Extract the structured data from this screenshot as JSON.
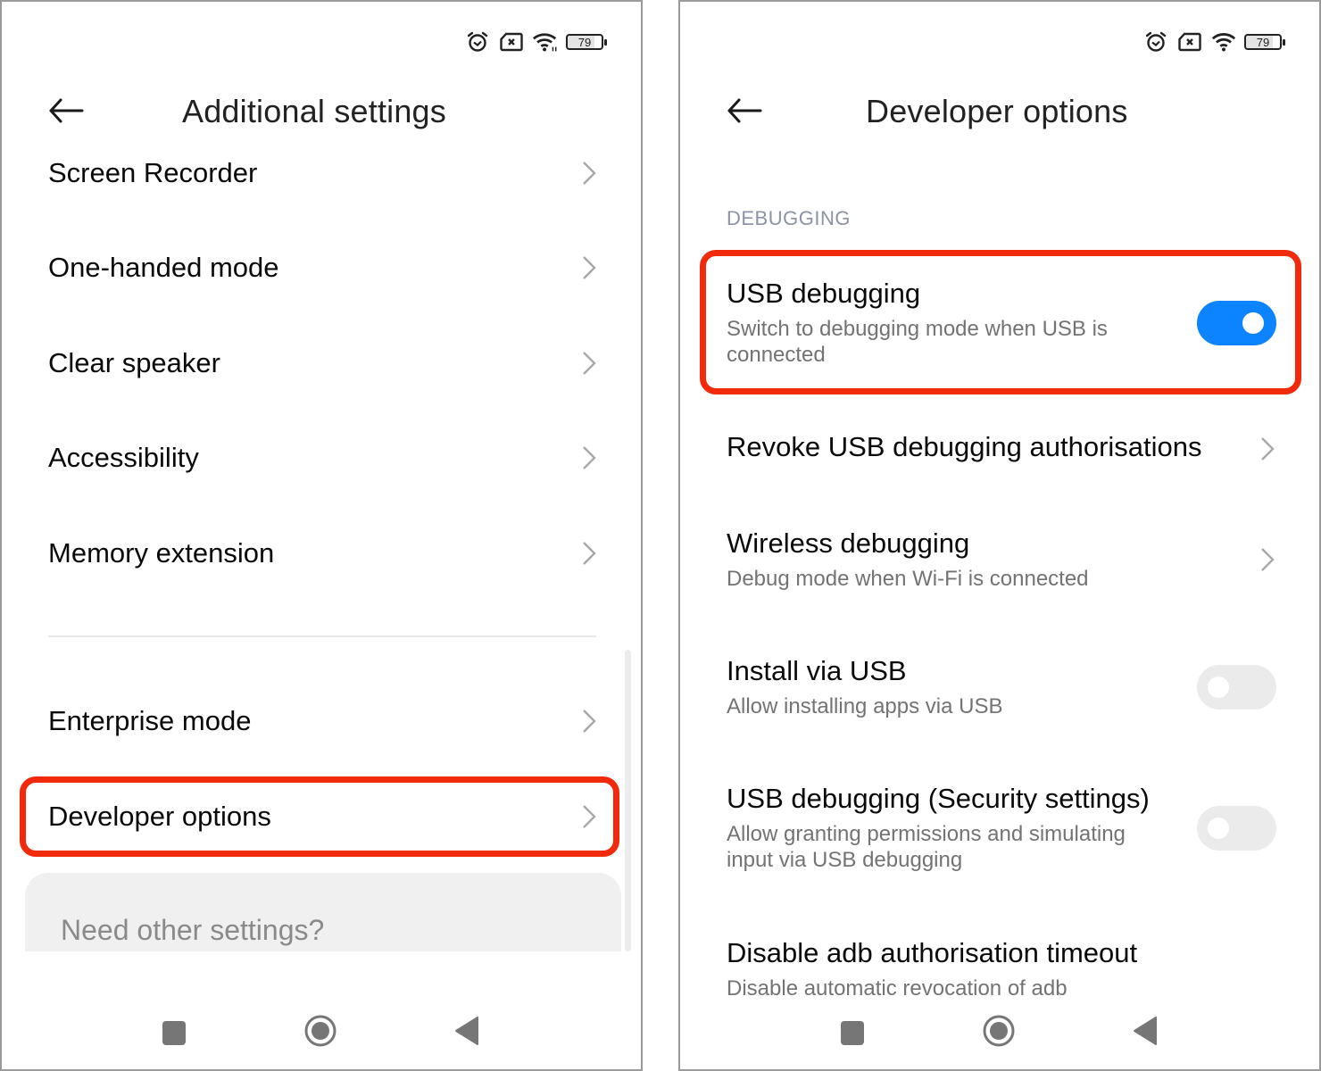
{
  "left_screen": {
    "status_bar": {
      "icons": [
        "alarm-icon",
        "no-sim-icon",
        "wifi-icon",
        "battery-icon"
      ],
      "battery_level": "79"
    },
    "header": {
      "back_icon": "arrow-left-icon",
      "title": "Additional settings"
    },
    "items": [
      {
        "label": "Screen Recorder",
        "icon": "chevron-right-icon"
      },
      {
        "label": "One-handed mode",
        "icon": "chevron-right-icon"
      },
      {
        "label": "Clear speaker",
        "icon": "chevron-right-icon"
      },
      {
        "label": "Accessibility",
        "icon": "chevron-right-icon"
      },
      {
        "label": "Memory extension",
        "icon": "chevron-right-icon"
      },
      {
        "label": "Enterprise mode",
        "icon": "chevron-right-icon"
      },
      {
        "label": "Developer options",
        "icon": "chevron-right-icon",
        "highlighted": true
      }
    ],
    "other_settings_card": {
      "text": "Need other settings?"
    },
    "nav_bar": [
      "recents-icon",
      "home-icon",
      "back-icon"
    ]
  },
  "right_screen": {
    "status_bar": {
      "icons": [
        "alarm-icon",
        "no-sim-icon",
        "wifi-icon",
        "battery-icon"
      ],
      "battery_level": "79"
    },
    "header": {
      "back_icon": "arrow-left-icon",
      "title": "Developer options"
    },
    "section_header": "DEBUGGING",
    "settings": [
      {
        "title": "USB debugging",
        "subtitle": "Switch to debugging mode when USB is connected",
        "control": "toggle",
        "enabled": true,
        "highlighted": true
      },
      {
        "title": "Revoke USB debugging authorisations",
        "subtitle": "",
        "control": "chevron"
      },
      {
        "title": "Wireless debugging",
        "subtitle": "Debug mode when Wi-Fi is connected",
        "control": "chevron"
      },
      {
        "title": "Install via USB",
        "subtitle": "Allow installing apps via USB",
        "control": "toggle",
        "enabled": false
      },
      {
        "title": "USB debugging (Security settings)",
        "subtitle": "Allow granting permissions and simulating input via USB debugging",
        "control": "toggle",
        "enabled": false
      },
      {
        "title": "Disable adb authorisation timeout",
        "subtitle": "Disable automatic revocation of adb",
        "control": "none"
      }
    ],
    "nav_bar": [
      "recents-icon",
      "home-icon",
      "back-icon"
    ]
  },
  "colors": {
    "highlight": "#f22a0c",
    "toggle_on": "#0d84ff",
    "toggle_off": "#ebebeb",
    "section_header": "#8d93a6"
  }
}
